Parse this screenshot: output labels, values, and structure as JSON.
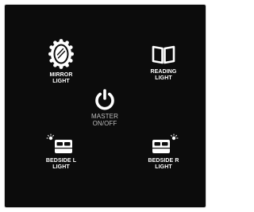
{
  "controls": {
    "mirror_light": {
      "line1": "MIRROR",
      "line2": "LIGHT",
      "icon": "mirror-icon"
    },
    "reading_light": {
      "line1": "READING",
      "line2": "LIGHT",
      "icon": "book-icon"
    },
    "master": {
      "line1": "MASTER",
      "line2": "ON/OFF",
      "icon": "power-icon"
    },
    "bedside_left": {
      "line1": "BEDSIDE L",
      "line2": "LIGHT",
      "icon": "bed-lamp-left-icon"
    },
    "bedside_right": {
      "line1": "BEDSIDE R",
      "line2": "LIGHT",
      "icon": "bed-lamp-right-icon"
    }
  },
  "colors": {
    "background": "#0c0c0c",
    "icon": "#ffffff",
    "secondary_text": "#bdbdbd"
  }
}
